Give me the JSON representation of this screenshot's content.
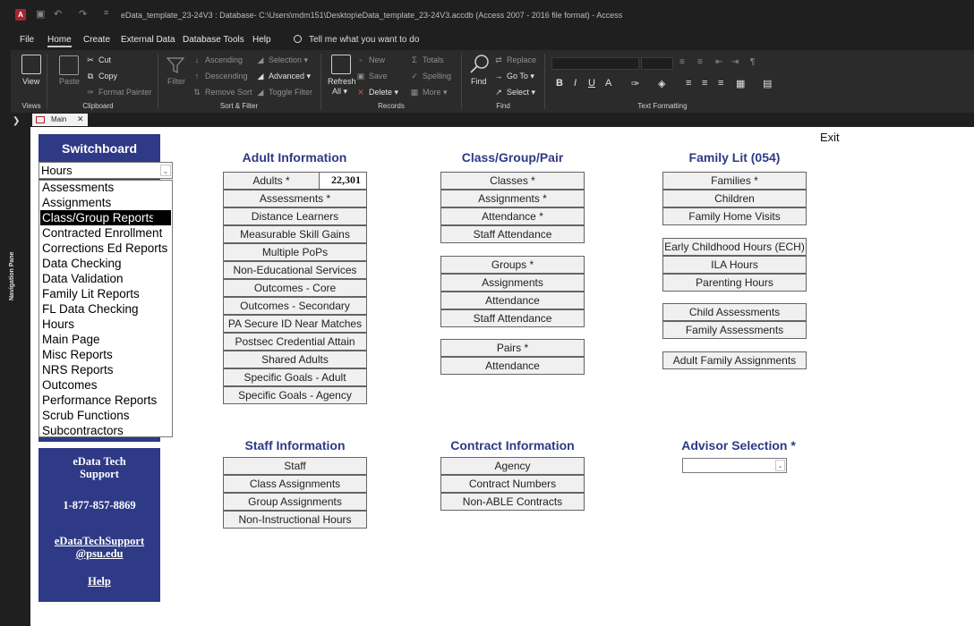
{
  "titlebar": {
    "app_letter": "A",
    "title": "eData_template_23-24V3 : Database- C:\\Users\\mdm151\\Desktop\\eData_template_23-24V3.accdb (Access 2007 - 2016 file format)  -  Access"
  },
  "menu": {
    "tabs": [
      "File",
      "Home",
      "Create",
      "External Data",
      "Database Tools",
      "Help"
    ],
    "active_tab": "Home",
    "tell_me": "Tell me what you want to do"
  },
  "ribbon": {
    "views": {
      "view": "View",
      "group": "Views"
    },
    "clipboard": {
      "paste": "Paste",
      "cut": "Cut",
      "copy": "Copy",
      "format_painter": "Format Painter",
      "group": "Clipboard"
    },
    "sort_filter": {
      "filter": "Filter",
      "ascending": "Ascending",
      "descending": "Descending",
      "remove_sort": "Remove Sort",
      "selection": "Selection",
      "advanced": "Advanced",
      "toggle_filter": "Toggle Filter",
      "group": "Sort & Filter"
    },
    "records": {
      "refresh": "Refresh",
      "refresh_all": "All",
      "new": "New",
      "save": "Save",
      "delete": "Delete",
      "totals": "Totals",
      "spelling": "Spelling",
      "more": "More",
      "group": "Records"
    },
    "find": {
      "find": "Find",
      "replace": "Replace",
      "go_to": "Go To",
      "select": "Select",
      "group": "Find"
    },
    "text_formatting": {
      "bold": "B",
      "italic": "I",
      "underline": "U",
      "font_color": "A",
      "group": "Text Formatting"
    }
  },
  "nav_pane": {
    "label": "Navigation Pane"
  },
  "doc_tab": {
    "label": "Main"
  },
  "form": {
    "exit": "Exit",
    "switchboard": {
      "title": "Switchboard",
      "combo_value": "Hours",
      "options": [
        "Assessments",
        "Assignments",
        "Class/Group Reports",
        "Contracted Enrollment",
        "Corrections Ed Reports",
        "Data Checking",
        "Data Validation",
        "Family Lit Reports",
        "FL Data Checking",
        "Hours",
        "Main Page",
        "Misc Reports",
        "NRS Reports",
        "Outcomes",
        "Performance Reports",
        "Scrub Functions",
        "Subcontractors"
      ],
      "selected_option": "Class/Group Reports"
    },
    "support": {
      "line1": "eData Tech",
      "line2": "Support",
      "phone": "1-877-857-8869",
      "email1": "eDataTechSupport",
      "email2": "@psu.edu",
      "help": "Help"
    },
    "adult": {
      "title": "Adult Information",
      "adults_label": "Adults *",
      "adults_count": "22,301",
      "buttons": [
        "Assessments *",
        "Distance Learners",
        "Measurable Skill Gains",
        "Multiple PoPs",
        "Non-Educational Services",
        "Outcomes - Core",
        "Outcomes - Secondary",
        "PA Secure ID Near Matches",
        "Postsec Credential Attain",
        "Shared Adults",
        "Specific Goals - Adult",
        "Specific Goals - Agency"
      ]
    },
    "class": {
      "title": "Class/Group/Pair",
      "classes": [
        "Classes *",
        "Assignments *",
        "Attendance *",
        "Staff Attendance"
      ],
      "groups": [
        "Groups *",
        "Assignments",
        "Attendance",
        "Staff Attendance"
      ],
      "pairs": [
        "Pairs *",
        "Attendance"
      ]
    },
    "family": {
      "title": "Family Lit (054)",
      "group1": [
        "Families *",
        "Children",
        "Family Home Visits"
      ],
      "group2": [
        "Early Childhood Hours (ECH)",
        "ILA Hours",
        "Parenting Hours"
      ],
      "group3": [
        "Child Assessments",
        "Family Assessments"
      ],
      "group4": [
        "Adult Family Assignments"
      ]
    },
    "staff": {
      "title": "Staff  Information",
      "buttons": [
        "Staff",
        "Class Assignments",
        "Group Assignments",
        "Non-Instructional Hours"
      ]
    },
    "contract": {
      "title": "Contract  Information",
      "buttons": [
        "Agency",
        "Contract Numbers",
        "Non-ABLE Contracts"
      ]
    },
    "advisor": {
      "title": "Advisor Selection *",
      "value": ""
    }
  }
}
